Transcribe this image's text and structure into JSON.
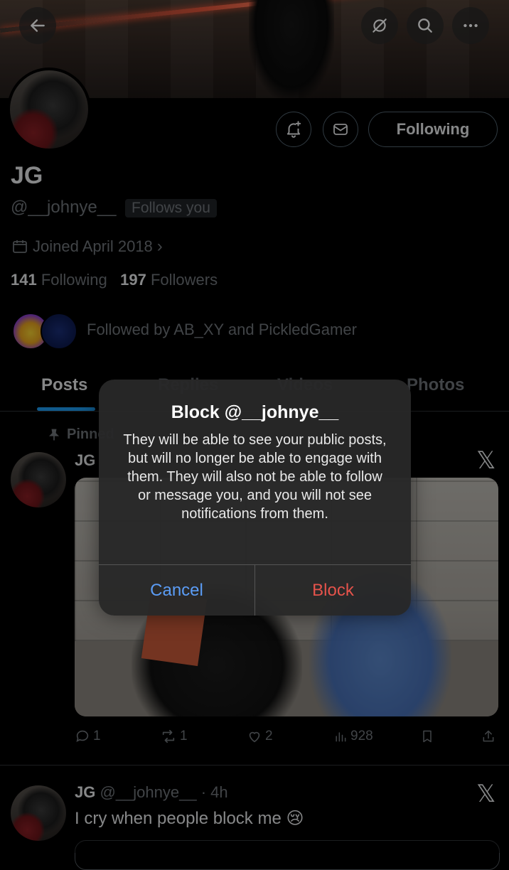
{
  "colors": {
    "background": "#000000",
    "link_blue": "#1d9bf0",
    "muted": "#71767b",
    "cancel_blue": "#5b9cf5",
    "block_red": "#e5534b"
  },
  "header": {
    "icons": [
      "back-arrow-icon",
      "no-camera-icon",
      "search-icon",
      "more-icon"
    ]
  },
  "profile": {
    "follow_button_label": "Following",
    "name": "JG",
    "handle": "@__johnye__",
    "follows_you_label": "Follows you",
    "joined": "Joined April 2018",
    "following_count": "141",
    "following_label": "Following",
    "followers_count": "197",
    "followers_label": "Followers",
    "followed_by": "Followed by AB_XY and PickledGamer"
  },
  "tabs": [
    "Posts",
    "Replies",
    "Videos",
    "Photos"
  ],
  "posts": [
    {
      "pinned_label": "Pinned",
      "name": "JG",
      "actions": {
        "replies": "1",
        "reposts": "1",
        "likes": "2",
        "views": "928"
      }
    },
    {
      "name": "JG",
      "handle": "@__johnye__",
      "time": "· 4h",
      "text": "I cry when people block me 😢"
    }
  ],
  "dialog": {
    "title": "Block @__johnye__",
    "message": "They will be able to see your public posts, but will no longer be able to engage with them. They will also not be able to follow or message you, and you will not see notifications from them.",
    "cancel_label": "Cancel",
    "confirm_label": "Block"
  }
}
